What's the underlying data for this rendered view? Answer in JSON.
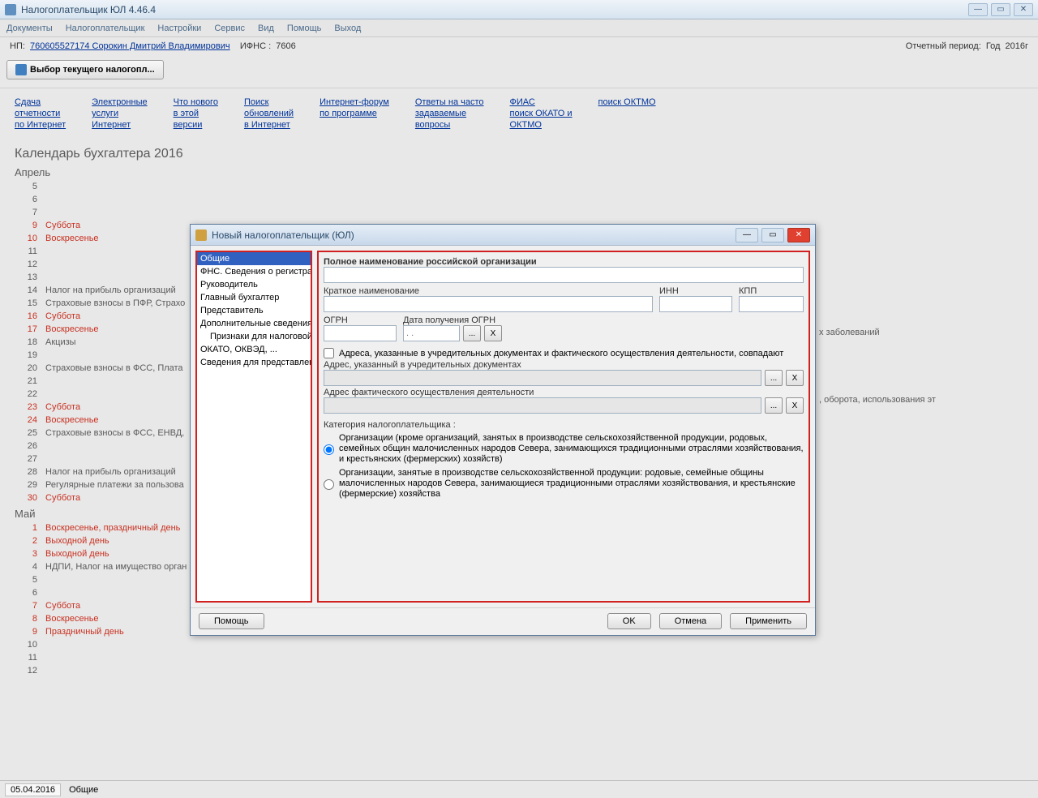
{
  "titlebar": {
    "title": "Налогоплательщик ЮЛ 4.46.4"
  },
  "menu": [
    "Документы",
    "Налогоплательщик",
    "Настройки",
    "Сервис",
    "Вид",
    "Помощь",
    "Выход"
  ],
  "info": {
    "np_label": "НП:",
    "np_value": "760605527174 Сорокин Дмитрий Владимирович",
    "ifns_label": "ИФНС :",
    "ifns_value": "7606",
    "period_label": "Отчетный период:",
    "year_label": "Год",
    "year_value": "2016г"
  },
  "toolbar": {
    "select_btn": "Выбор текущего налогопл..."
  },
  "links": [
    [
      "Сдача",
      "отчетности",
      "по Интернет"
    ],
    [
      "Электронные",
      "услуги",
      "Интернет"
    ],
    [
      "Что нового",
      "в этой",
      "версии"
    ],
    [
      "Поиск",
      "обновлений",
      "в Интернет"
    ],
    [
      "Интернет-форум",
      "по программе"
    ],
    [
      "Ответы на часто",
      "задаваемые",
      "вопросы"
    ],
    [
      "ФИАС",
      "поиск ОКАТО и",
      "ОКТМО"
    ],
    [
      "поиск ОКТМО"
    ]
  ],
  "calendar": {
    "title": "Календарь бухгалтера 2016",
    "months": [
      {
        "name": "Апрель",
        "days": [
          {
            "n": "5",
            "t": "",
            "r": false
          },
          {
            "n": "6",
            "t": "",
            "r": false
          },
          {
            "n": "7",
            "t": "",
            "r": false
          },
          {
            "n": "9",
            "t": "Суббота",
            "r": true
          },
          {
            "n": "10",
            "t": "Воскресенье",
            "r": true
          },
          {
            "n": "11",
            "t": "",
            "r": false
          },
          {
            "n": "12",
            "t": "",
            "r": false
          },
          {
            "n": "13",
            "t": "",
            "r": false
          },
          {
            "n": "14",
            "t": "Налог на прибыль организаций",
            "r": false
          },
          {
            "n": "15",
            "t": "Страховые взносы в ПФР, Страхо",
            "r": false
          },
          {
            "n": "16",
            "t": "Суббота",
            "r": true
          },
          {
            "n": "17",
            "t": "Воскресенье",
            "r": true
          },
          {
            "n": "18",
            "t": "Акцизы",
            "r": false
          },
          {
            "n": "19",
            "t": "",
            "r": false
          },
          {
            "n": "20",
            "t": "Страховые взносы в ФСС, Плата",
            "r": false
          },
          {
            "n": "21",
            "t": "",
            "r": false
          },
          {
            "n": "22",
            "t": "",
            "r": false
          },
          {
            "n": "23",
            "t": "Суббота",
            "r": true
          },
          {
            "n": "24",
            "t": "Воскресенье",
            "r": true
          },
          {
            "n": "25",
            "t": "Страховые взносы в ФСС, ЕНВД,",
            "r": false
          },
          {
            "n": "26",
            "t": "",
            "r": false
          },
          {
            "n": "27",
            "t": "",
            "r": false
          },
          {
            "n": "28",
            "t": "Налог на прибыль организаций",
            "r": false
          },
          {
            "n": "29",
            "t": "Регулярные платежи за пользова",
            "r": false
          },
          {
            "n": "30",
            "t": "Суббота",
            "r": true
          }
        ]
      },
      {
        "name": "Май",
        "days": [
          {
            "n": "1",
            "t": "Воскресенье, праздничный день",
            "r": true
          },
          {
            "n": "2",
            "t": "Выходной день",
            "r": true
          },
          {
            "n": "3",
            "t": "Выходной день",
            "r": true
          },
          {
            "n": "4",
            "t": "НДПИ, Налог на имущество орган",
            "r": false
          },
          {
            "n": "5",
            "t": "",
            "r": false
          },
          {
            "n": "6",
            "t": "",
            "r": false
          },
          {
            "n": "7",
            "t": "Суббота",
            "r": true
          },
          {
            "n": "8",
            "t": "Воскресенье",
            "r": true
          },
          {
            "n": "9",
            "t": "Праздничный день",
            "r": true
          },
          {
            "n": "10",
            "t": "",
            "r": false
          },
          {
            "n": "11",
            "t": "",
            "r": false
          },
          {
            "n": "12",
            "t": "",
            "r": false
          }
        ]
      }
    ],
    "bg_text1": "х заболеваний",
    "bg_text2": ", оборота, использования эт"
  },
  "dialog": {
    "title": "Новый налогоплательщик (ЮЛ)",
    "nav": [
      "Общие",
      "ФНС. Сведения о регистрац",
      "Руководитель",
      "Главный бухгалтер",
      "Представитель",
      "Дополнительные сведения",
      "Признаки для налоговой",
      "ОКАТО, ОКВЭД, ...",
      "Сведения для представлени"
    ],
    "form": {
      "full_name": "Полное наименование российской организации",
      "short_name": "Краткое наименование",
      "inn": "ИНН",
      "kpp": "КПП",
      "ogrn": "ОГРН",
      "ogrn_date": "Дата получения ОГРН",
      "addr_same": "Адреса, указанные в учредительных документах и фактического осуществления деятельности, совпадают",
      "addr_legal": "Адрес, указанный в учредительных документах",
      "addr_actual": "Адрес фактического осуществления деятельности",
      "category": "Категория налогоплательщика :",
      "cat1": "Организации (кроме организаций, занятых в производстве сельскохозяйственной продукции, родовых, семейных общин малочисленных народов Севера, занимающихся традиционными отраслями хозяйствования, и крестьянских (фермерских) хозяйств)",
      "cat2": "Организации, занятые в производстве сельскохозяйственной продукции: родовые, семейные общины малочисленных народов Севера, занимающиеся традиционными отраслями хозяйствования, и крестьянские (фермерские) хозяйства",
      "date_placeholder": ". ."
    },
    "buttons": {
      "help": "Помощь",
      "ok": "OK",
      "cancel": "Отмена",
      "apply": "Применить"
    }
  },
  "statusbar": {
    "date": "05.04.2016",
    "section": "Общие"
  }
}
